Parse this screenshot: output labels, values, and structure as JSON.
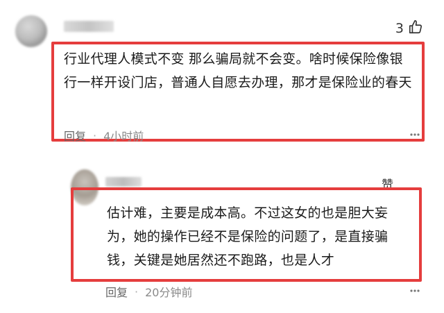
{
  "comments": [
    {
      "like_count": "3",
      "text": "行业代理人模式不变 那么骗局就不会变。啥时候保险像银行一样开设门店，普通人自愿去办理，那才是保险业的春天",
      "reply_label": "回复",
      "separator": "·",
      "time": "4小时前"
    }
  ],
  "reply": {
    "like_label": "赞",
    "lines": [
      "估计难，主要是成本高。不过这女的也是胆大妄",
      "为，她的操作已经不是保险的问题了，是直接骗",
      "钱，关键是她居然还不跑路，也是人才"
    ],
    "reply_label": "回复",
    "separator": "·",
    "time": "20分钟前"
  },
  "colors": {
    "highlight": "#e53d3d"
  }
}
